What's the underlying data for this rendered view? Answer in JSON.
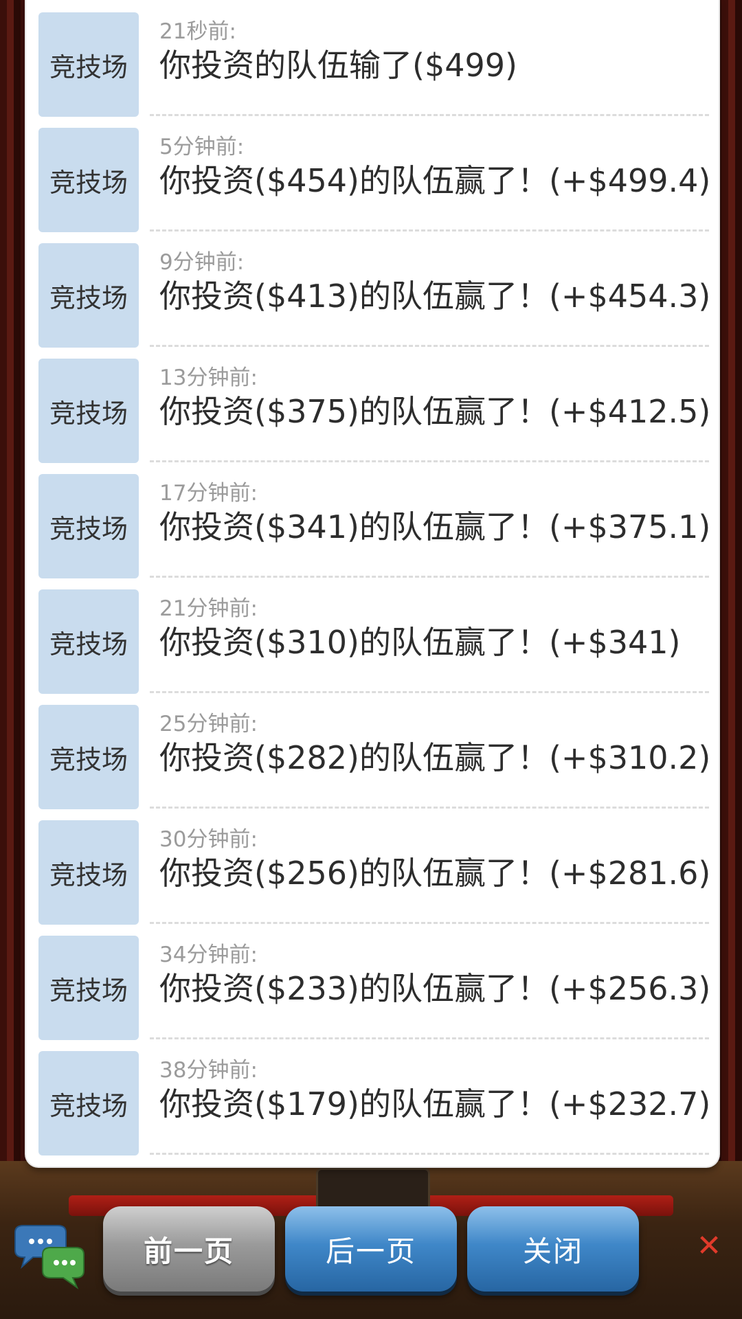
{
  "records": [
    {
      "tag": "竞技场",
      "time": "21秒前:",
      "message": "你投资的队伍输了($499)"
    },
    {
      "tag": "竞技场",
      "time": "5分钟前:",
      "message": "你投资($454)的队伍赢了！(+$499.4)"
    },
    {
      "tag": "竞技场",
      "time": "9分钟前:",
      "message": "你投资($413)的队伍赢了！(+$454.3)"
    },
    {
      "tag": "竞技场",
      "time": "13分钟前:",
      "message": "你投资($375)的队伍赢了！(+$412.5)"
    },
    {
      "tag": "竞技场",
      "time": "17分钟前:",
      "message": "你投资($341)的队伍赢了！(+$375.1)"
    },
    {
      "tag": "竞技场",
      "time": "21分钟前:",
      "message": "你投资($310)的队伍赢了！(+$341)"
    },
    {
      "tag": "竞技场",
      "time": "25分钟前:",
      "message": "你投资($282)的队伍赢了！(+$310.2)"
    },
    {
      "tag": "竞技场",
      "time": "30分钟前:",
      "message": "你投资($256)的队伍赢了！(+$281.6)"
    },
    {
      "tag": "竞技场",
      "time": "34分钟前:",
      "message": "你投资($233)的队伍赢了！(+$256.3)"
    },
    {
      "tag": "竞技场",
      "time": "38分钟前:",
      "message": "你投资($179)的队伍赢了！(+$232.7)"
    }
  ],
  "buttons": {
    "prev_label": "前一页",
    "next_label": "后一页",
    "close_label": "关闭"
  },
  "icons": {
    "chat": "chat-bubbles-icon",
    "close_x": "close-x-icon"
  },
  "colors": {
    "tag_background": "#c9dcee",
    "primary_button": "#3f87c8",
    "disabled_button": "#9a9a9a"
  }
}
